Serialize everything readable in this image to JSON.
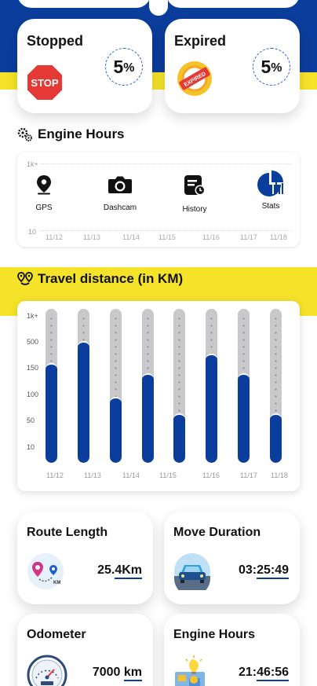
{
  "status_cards": [
    {
      "title": "Stopped",
      "percent": "5",
      "unit": "%",
      "icon": "stop-sign-icon",
      "badge_text": "STOP"
    },
    {
      "title": "Expired",
      "percent": "5",
      "unit": "%",
      "icon": "expired-badge-icon",
      "badge_text": "EXPIRED"
    }
  ],
  "engine_hours": {
    "title": "Engine Hours",
    "y_ticks": [
      "1k+",
      "10"
    ],
    "x_labels": [
      "11/12",
      "11/13",
      "11/14",
      "11/15",
      "11/16",
      "11/17",
      "11/18"
    ]
  },
  "nav": [
    {
      "label": "GPS",
      "icon": "gps-pin-icon"
    },
    {
      "label": "Dashcam",
      "icon": "camera-icon"
    },
    {
      "label": "History",
      "icon": "history-icon"
    },
    {
      "label": "Stats",
      "icon": "pie-chart-icon"
    }
  ],
  "travel": {
    "title": "Travel distance (in KM)"
  },
  "chart_data": {
    "type": "bar",
    "categories": [
      "11/12",
      "11/13",
      "11/14",
      "11/15",
      "11/16",
      "11/17",
      "11/18"
    ],
    "values": [
      175,
      550,
      80,
      140,
      40,
      340,
      140,
      40
    ],
    "y_ticks": [
      "1k+",
      "500",
      "150",
      "100",
      "50",
      "10"
    ],
    "x_labels": [
      "11/12",
      "11/13",
      "11/14",
      "11/15",
      "11/16",
      "11/17",
      "11/18"
    ],
    "fill_fractions": [
      0.65,
      0.79,
      0.43,
      0.58,
      0.32,
      0.71,
      0.58,
      0.32
    ],
    "bar_count": 8,
    "color": "#0b3d9c"
  },
  "stats": [
    {
      "title": "Route Length",
      "value_prefix": "25.",
      "value_underlined": "4Km",
      "icon": "route-map-icon"
    },
    {
      "title": "Move Duration",
      "value_prefix": "03:",
      "value_underlined": "25:49",
      "icon": "car-icon"
    },
    {
      "title": "Odometer",
      "value_prefix": "7000 ",
      "value_underlined": "km",
      "icon": "speedometer-icon"
    },
    {
      "title": "Engine Hours",
      "value_prefix": "21:",
      "value_underlined": "46:56",
      "icon": "engine-bulb-icon"
    }
  ],
  "colors": {
    "brand_blue": "#0b3d9c",
    "accent_yellow": "#f5e32a",
    "stop_red": "#e53935",
    "expired_orange": "#f5a623"
  }
}
